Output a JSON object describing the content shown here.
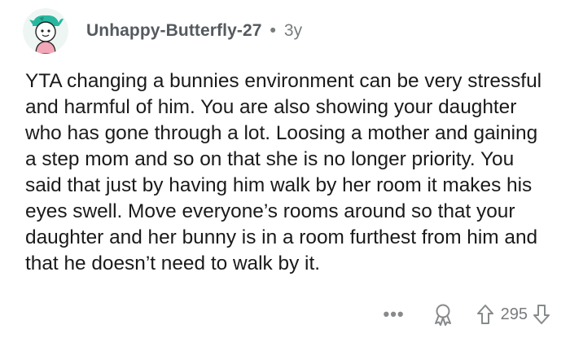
{
  "comment": {
    "author": "Unhappy-Butterfly-27",
    "separator": "•",
    "age": "3y",
    "body": "YTA changing a bunnies environment can be very stressful and harmful of him. You are also showing your daughter who has gone through a lot. Loosing a mother and gaining a step mom and so on that she is no longer priority. You said that just by having him walk by her room it makes his eyes swell. Move everyone’s rooms around so that your daughter and her bunny is in a room furthest from him and that he doesn’t need to walk by it."
  },
  "actions": {
    "more": "•••",
    "score": "295",
    "icons": [
      "more-options-icon",
      "award-icon",
      "upvote-arrow-icon",
      "downvote-arrow-icon"
    ]
  }
}
